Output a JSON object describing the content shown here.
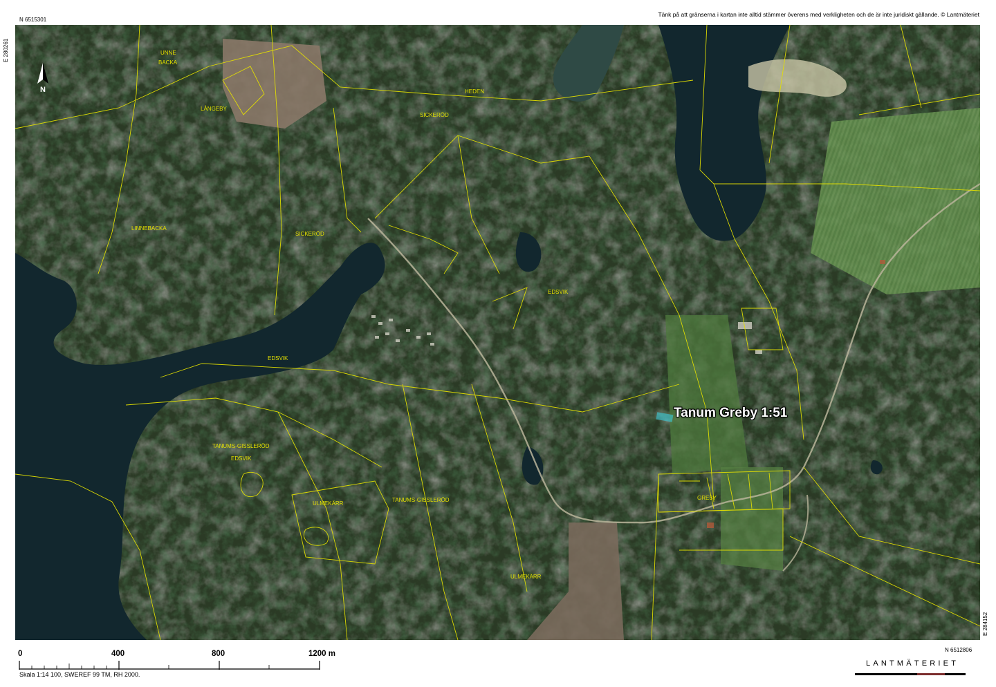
{
  "header": {
    "coord_nw_n": "N 6515301",
    "coord_nw_e": "E 280261",
    "disclaimer": "Tänk på att gränserna i kartan inte alltid stämmer överens med verkligheten och de är inte juridiskt gällande. © Lantmäteriet"
  },
  "footer": {
    "coord_se_n": "N 6512806",
    "coord_se_e": "E 284152",
    "scale_ticks": [
      "0",
      "400",
      "800",
      "1200 m"
    ],
    "scale_text": "Skala 1:14 100, SWEREF 99 TM, RH 2000.",
    "logo": "LANTMÄTERIET"
  },
  "map": {
    "highlight_label": "Tanum Greby 1:51",
    "highlight_color": "#3ad6e6",
    "boundary_color": "#e4e000",
    "north_arrow": "north-arrow-icon",
    "place_names": [
      "UNNE",
      "BACKA",
      "LÅNGEBY",
      "HEDEN",
      "SICKERÖD",
      "LINNEBACKA",
      "SICKERÖD",
      "EDSVIK",
      "EDSVIK",
      "TANUMS-GISSLERÖD",
      "EDSVIK",
      "ULMEKÄRR",
      "TANUMS-GISSLERÖD",
      "ULMEKÄRR",
      "GREBY"
    ]
  }
}
